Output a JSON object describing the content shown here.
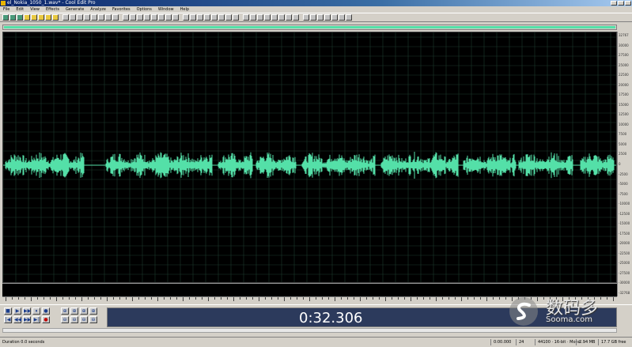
{
  "titlebar": {
    "title": "el_Nokia_1050_1.wav* - Cool Edit Pro"
  },
  "menu": [
    "File",
    "Edit",
    "View",
    "Effects",
    "Generate",
    "Analyze",
    "Favorites",
    "Options",
    "Window",
    "Help"
  ],
  "waveform": {
    "color": "#54e0a8",
    "background": "#000000",
    "grid_color": "#1c3a2c"
  },
  "vruler": {
    "labels": [
      "32767",
      "30000",
      "27500",
      "25000",
      "22500",
      "20000",
      "17500",
      "15000",
      "12500",
      "10000",
      "7500",
      "5000",
      "2500",
      "0",
      "-2500",
      "-5000",
      "-7500",
      "-10000",
      "-12500",
      "-15000",
      "-17500",
      "-20000",
      "-22500",
      "-25000",
      "-27500",
      "-30000",
      "-32768"
    ]
  },
  "transport": {
    "time": "0:32.306",
    "buttons_row1": [
      "■",
      "▶",
      "▶▶",
      "⏸",
      "●"
    ],
    "buttons_row2": [
      "|◀",
      "◀◀",
      "▶▶",
      "▶|",
      "●"
    ],
    "zoom_row1": [
      "⊕",
      "⊕",
      "⊕",
      "⊕"
    ],
    "zoom_row2": [
      "⊖",
      "⊖",
      "⊖",
      "⊖"
    ]
  },
  "watermark": {
    "cn": "数码多",
    "url": "Sooma.com"
  },
  "statusbar": {
    "left": "Duration 0.0 seconds",
    "f1": "0:00.000",
    "f2": "24",
    "f3": "44100 · 16-bit · Mono",
    "f4": "2.94 MB",
    "f5": "17.7 GB free"
  }
}
